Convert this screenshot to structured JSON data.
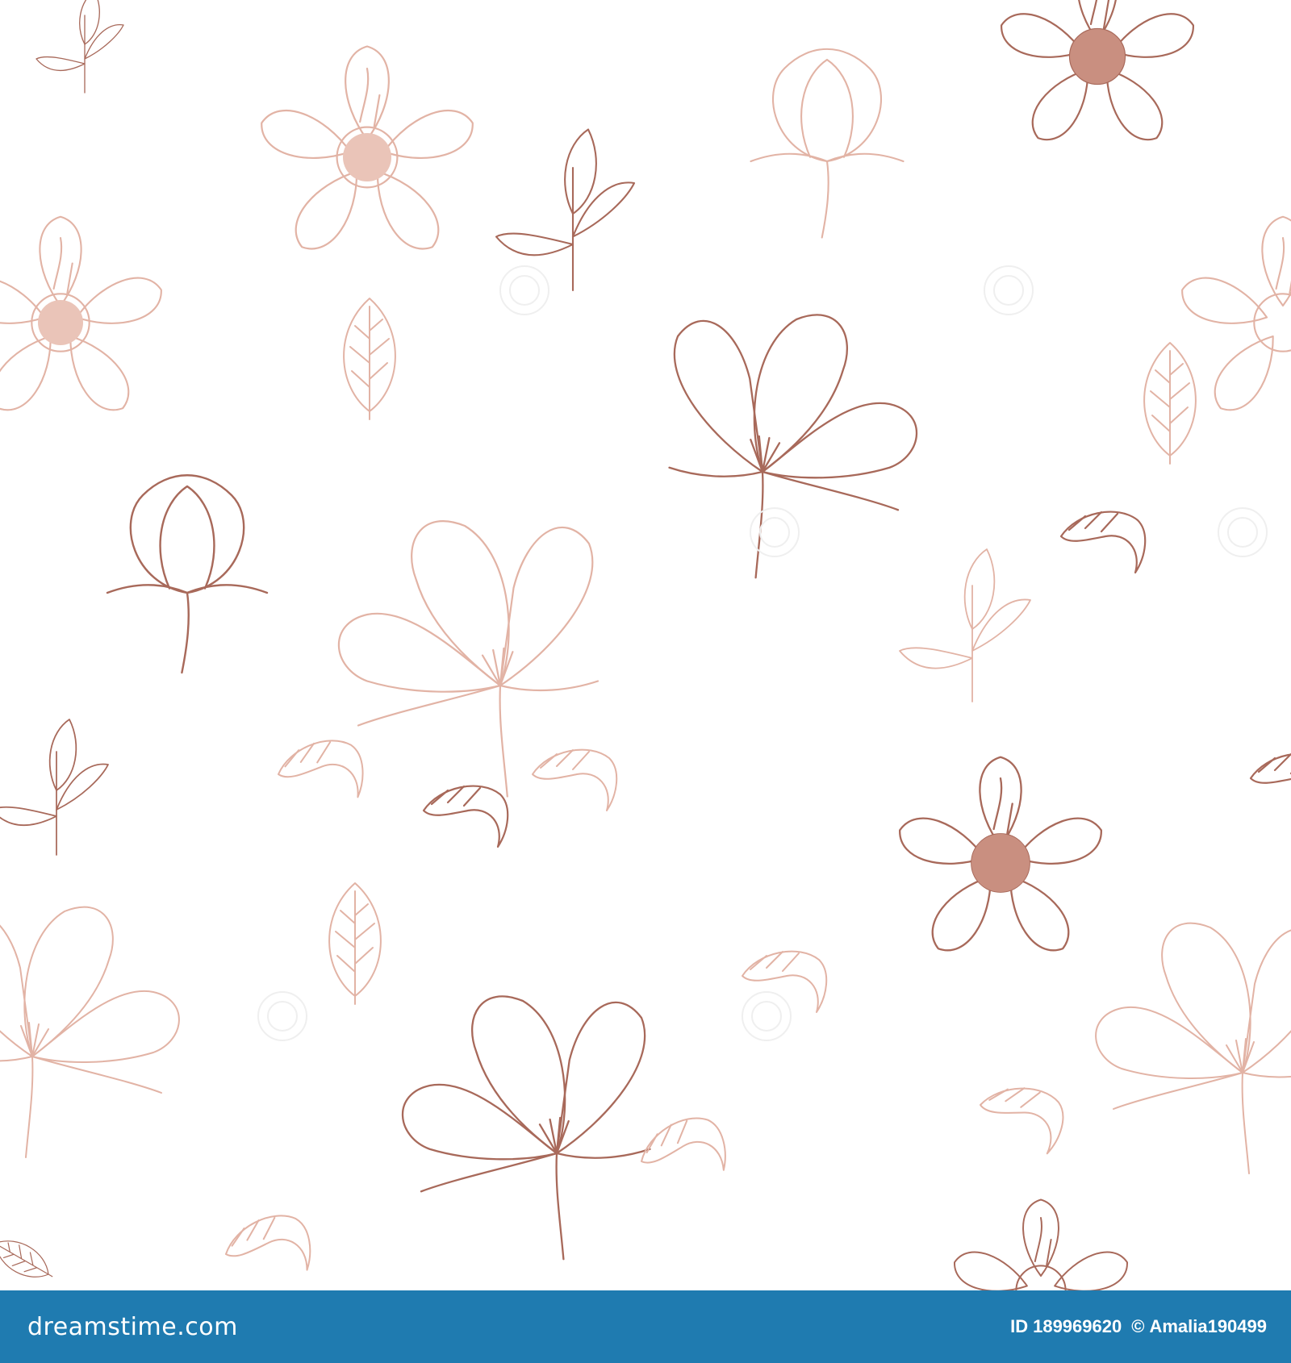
{
  "image": {
    "subject": "seamless floral line-art pattern",
    "palette": {
      "background": "#ffffff",
      "rose_gold_dark": "#a8695a",
      "rose_gold_light": "#e2b3a5",
      "rose_gold_fill": "#c98f80",
      "footer_bar": "#1f7bb0"
    }
  },
  "footer": {
    "brand_text": "dreamstime.com",
    "id_label": "ID",
    "id_value": "189969620",
    "copyright_symbol": "©",
    "author": "Amalia190499"
  }
}
